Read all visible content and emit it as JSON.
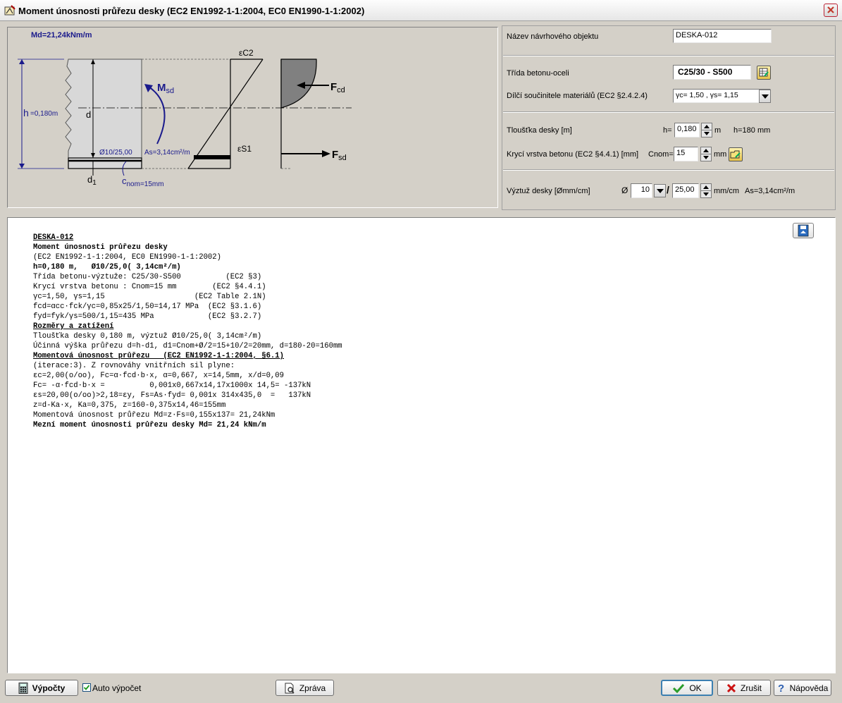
{
  "window": {
    "title": "Moment únosnosti průřezu desky (EC2 EN1992-1-1:2004, EC0 EN1990-1-1:2002)"
  },
  "diagram": {
    "md": "Md=21,24kNm/m",
    "h": "h",
    "h_value": "=0,180m",
    "msd": "M",
    "msd_sub": "sd",
    "d": "d",
    "bar": "Ø10/25,00",
    "as": "As=3,14cm²/m",
    "d1": "d",
    "d1_sub": "1",
    "cnom": "c",
    "cnom_sub": "nom=15mm",
    "ec2": "εC2",
    "es1": "εS1",
    "fcd": "F",
    "fcd_sub": "cd",
    "fsd": "F",
    "fsd_sub": "sd"
  },
  "params": {
    "name_label": "Název návrhového objektu",
    "name_value": "DESKA-012",
    "class_label": "Třída betonu-oceli",
    "class_value": "C25/30 - S500",
    "factors_label": "Dílčí součinitele materiálů (EC2 §2.4.2.4)",
    "factors_value": "γc= 1,50 , γs= 1,15",
    "thickness_label": "Tloušťka desky [m]",
    "h_prefix": "h=",
    "h_value": "0,180",
    "h_unit": "m",
    "h_mm": "h=180 mm",
    "cover_label": "Krycí vrstva betonu (EC2 §4.4.1) [mm]",
    "cnom_prefix": "Cnom=",
    "cnom_value": "15",
    "cnom_unit": "mm",
    "reinf_label": "Výztuž desky [Ømm/cm]",
    "diam_symbol": "Ø",
    "diam_value": "10",
    "slash": "/",
    "spacing_value": "25,00",
    "spacing_unit": "mm/cm",
    "as_text": "As=3,14cm²/m"
  },
  "report": {
    "lines": [
      "DESKA-012",
      "Moment únosnosti průřezu desky",
      "(EC2 EN1992-1-1:2004, EC0 EN1990-1-1:2002)",
      "h=0,180 m,   Ø10/25,0( 3,14cm²/m)",
      "Třída betonu-výztuže: C25/30-S500          (EC2 §3)",
      "Krycí vrstva betonu : Cnom=15 mm        (EC2 §4.4.1)",
      "γc=1,50, γs=1,15                    (EC2 Table 2.1N)",
      "fcd=αcc·fck/γc=0,85x25/1,50=14,17 MPa  (EC2 §3.1.6)",
      "fyd=fyk/γs=500/1,15=435 MPa            (EC2 §3.2.7)",
      "Rozměry a zatížení",
      "Tloušťka desky 0,180 m, výztuž Ø10/25,0( 3,14cm²/m)",
      "Účinná výška průřezu d=h-d1, d1=Cnom+Ø/2=15+10/2=20mm, d=180-20=160mm",
      "Momentová únosnost průřezu   (EC2 EN1992-1-1:2004, §6.1)",
      "(iterace:3). Z rovnováhy vnitřních sil plyne:",
      "εc=2,00(o/oo), Fc=α·fcd·b·x, α=0,667, x=14,5mm, x/d=0,09",
      "Fc= -α·fcd·b·x =          0,001x0,667x14,17x1000x 14,5= -137kN",
      "εs=20,00(o/oo)>2,18=εy, Fs=As·fyd= 0,001x 314x435,0  =   137kN",
      "z=d-Ka·x, Ka=0,375, z=160-0,375x14,46=155mm",
      "Momentová únosnost průřezu Md=z·Fs=0,155x137= 21,24kNm",
      "Mezní moment únosnosti průřezu desky Md= 21,24 kNm/m"
    ]
  },
  "footer": {
    "calc_label": "Výpočty",
    "auto_label": "Auto výpočet",
    "report_label": "Zpráva",
    "ok_label": "OK",
    "cancel_label": "Zrušit",
    "help_label": "Nápověda"
  },
  "colors": {
    "accent": "#1a1a8c",
    "label_blue": "#0000a0",
    "ok_green": "#2a9d2a",
    "cancel_red": "#cc1111"
  }
}
